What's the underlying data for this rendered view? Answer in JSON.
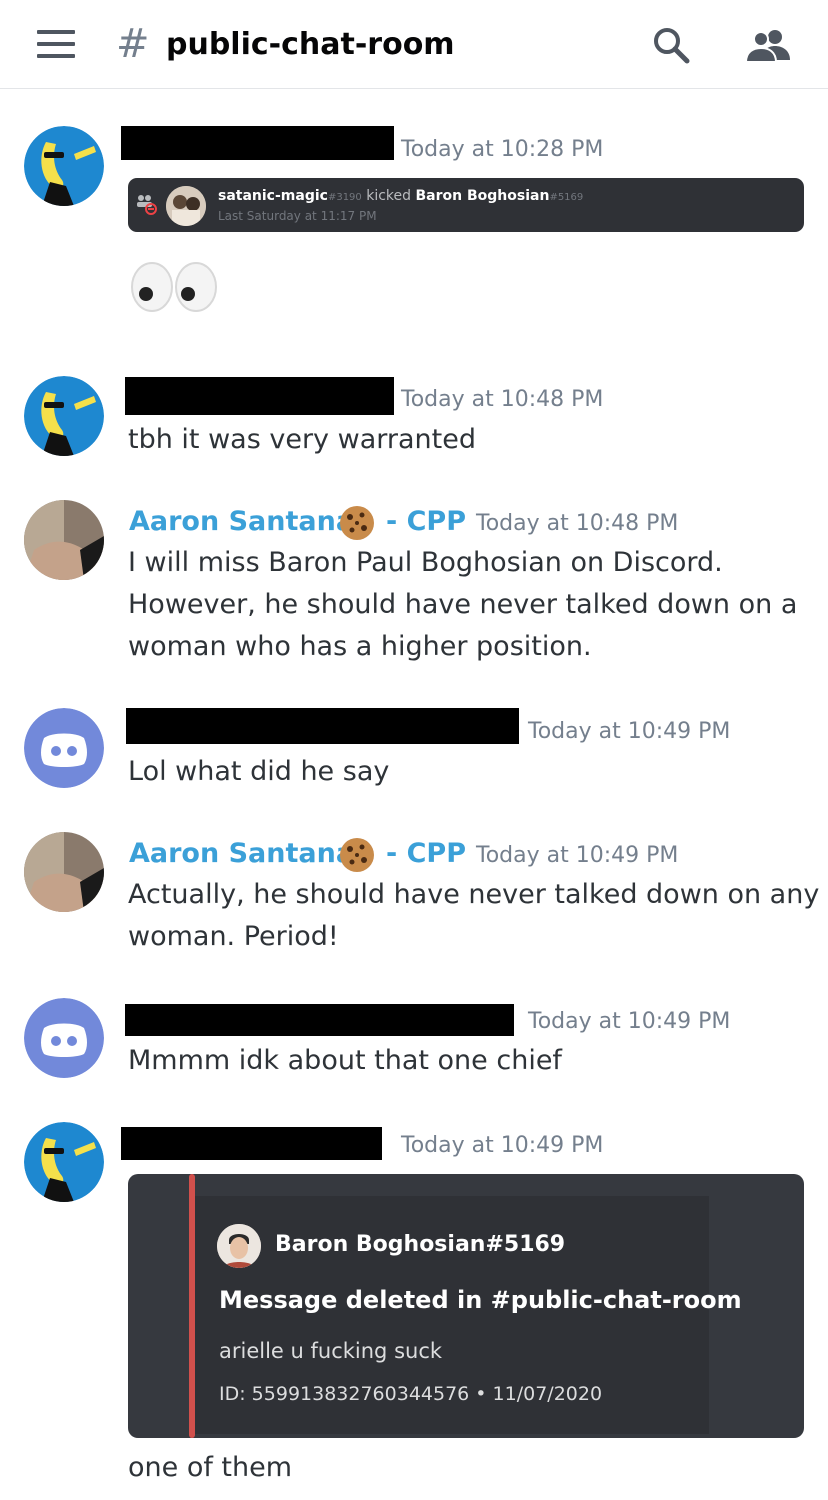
{
  "header": {
    "channel_hash": "#",
    "channel_name": "public-chat-room",
    "menu_icon": "hamburger-menu-icon",
    "search_icon": "search-icon",
    "members_icon": "members-icon"
  },
  "messages": [
    {
      "timestamp": "Today at 10:28 PM",
      "system_event": {
        "actor": "satanic-magic",
        "actor_disc": "#3190",
        "action": "kicked",
        "target": "Baron Boghosian",
        "target_disc": "#5169",
        "time": "Last Saturday at 11:17 PM"
      },
      "emoji": "eyes"
    },
    {
      "timestamp": "Today at 10:48 PM",
      "text": "tbh it was very warranted"
    },
    {
      "username": "Aaron Santana",
      "suffix": "- CPP",
      "timestamp": "Today at 10:48 PM",
      "lines": [
        "I will miss Baron Paul Boghosian on Discord.",
        "However, he should have never talked down on a",
        "woman who has a higher position."
      ]
    },
    {
      "timestamp": "Today at 10:49 PM",
      "text": "Lol what did he say"
    },
    {
      "username": "Aaron Santana",
      "suffix": "- CPP",
      "timestamp": "Today at 10:49 PM",
      "lines": [
        "Actually, he should have never talked down on any",
        "woman. Period!"
      ]
    },
    {
      "timestamp": "Today at 10:49 PM",
      "text": "Mmmm idk about that one chief"
    },
    {
      "timestamp": "Today at 10:49 PM",
      "embed": {
        "author": "Baron Boghosian#5169",
        "title": "Message deleted in #public-chat-room",
        "description": "arielle u fucking suck",
        "footer": "ID: 559913832760344576 • 11/07/2020"
      },
      "text": "one of them"
    }
  ],
  "colors": {
    "username": "#3ba0d8",
    "timestamp": "#747f8d",
    "embed_accent": "#d1504c",
    "discord_blurple": "#7289da"
  }
}
